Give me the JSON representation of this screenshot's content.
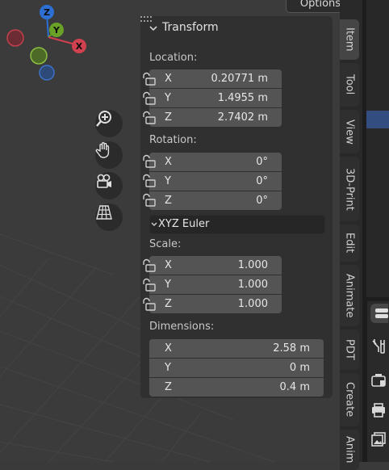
{
  "header": {
    "options_label": "Options"
  },
  "gizmo": {
    "z_label": "Z",
    "y_label": "Y",
    "x_label": "X"
  },
  "panel": {
    "title": "Transform",
    "location": {
      "label": "Location:",
      "x": {
        "axis": "X",
        "value": "0.20771 m"
      },
      "y": {
        "axis": "Y",
        "value": "1.4955 m"
      },
      "z": {
        "axis": "Z",
        "value": "2.7402 m"
      }
    },
    "rotation": {
      "label": "Rotation:",
      "x": {
        "axis": "X",
        "value": "0°"
      },
      "y": {
        "axis": "Y",
        "value": "0°"
      },
      "z": {
        "axis": "Z",
        "value": "0°"
      },
      "mode": "XYZ Euler"
    },
    "scale": {
      "label": "Scale:",
      "x": {
        "axis": "X",
        "value": "1.000"
      },
      "y": {
        "axis": "Y",
        "value": "1.000"
      },
      "z": {
        "axis": "Z",
        "value": "1.000"
      }
    },
    "dimensions": {
      "label": "Dimensions:",
      "x": {
        "axis": "X",
        "value": "2.58 m"
      },
      "y": {
        "axis": "Y",
        "value": "0 m"
      },
      "z": {
        "axis": "Z",
        "value": "0.4 m"
      }
    }
  },
  "sidebar_tabs": [
    {
      "label": "Item",
      "active": true
    },
    {
      "label": "Tool"
    },
    {
      "label": "View"
    },
    {
      "label": "3D-Print"
    },
    {
      "label": "Edit"
    },
    {
      "label": "Animate"
    },
    {
      "label": "PDT"
    },
    {
      "label": "Create"
    },
    {
      "label": "Anim"
    }
  ],
  "colors": {
    "x_axis": "#d0414f",
    "y_axis": "#6aa127",
    "z_axis": "#2d6fd2",
    "selection": "#334d80"
  },
  "icons": {
    "zoom": "zoom-icon",
    "pan": "hand-icon",
    "camera": "camera-icon",
    "grid": "grid-icon",
    "lock": "lock-icon",
    "wrench": "wrench-icon",
    "render": "render-icon",
    "output": "printer-icon",
    "view_layer": "image-icon"
  }
}
